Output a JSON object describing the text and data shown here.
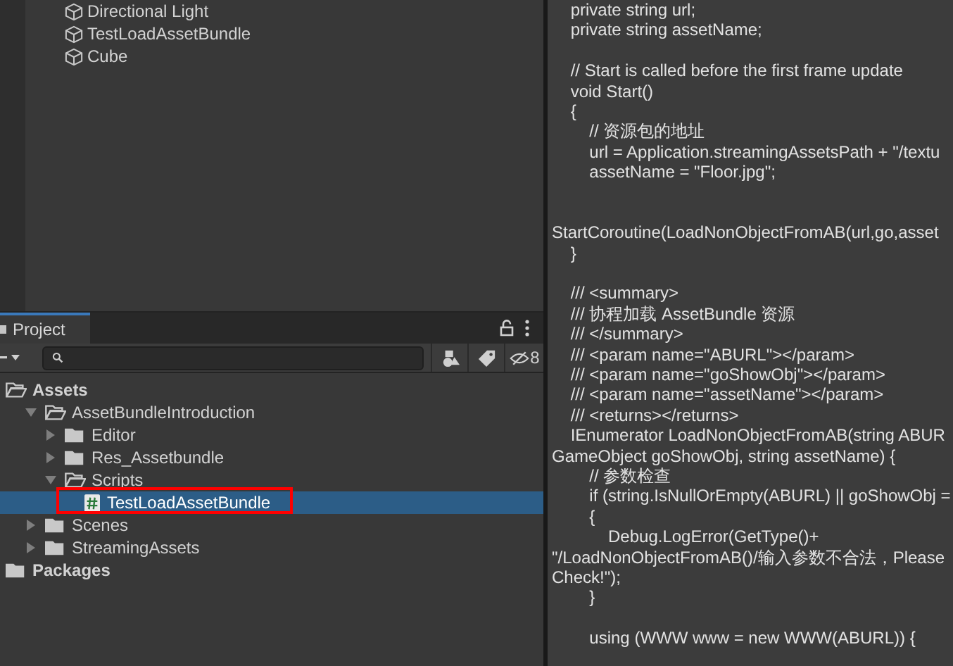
{
  "hierarchy": {
    "items": [
      {
        "label": "Directional Light"
      },
      {
        "label": "TestLoadAssetBundle"
      },
      {
        "label": "Cube"
      }
    ]
  },
  "project": {
    "tab": {
      "label": "Project",
      "selected": true
    },
    "hidden_count": "8",
    "tree": [
      {
        "label": "Assets",
        "kind": "folder",
        "root": true,
        "expanded": true,
        "selected": false,
        "highlighted": false,
        "children": [
          {
            "label": "AssetBundleIntroduction",
            "kind": "folder",
            "expanded": true,
            "selected": false,
            "highlighted": false,
            "children": [
              {
                "label": "Editor",
                "kind": "folder",
                "expanded": false,
                "selected": false,
                "highlighted": false
              },
              {
                "label": "Res_Assetbundle",
                "kind": "folder",
                "expanded": false,
                "selected": false,
                "highlighted": false
              },
              {
                "label": "Scripts",
                "kind": "folder",
                "expanded": true,
                "selected": false,
                "highlighted": false,
                "children": [
                  {
                    "label": "TestLoadAssetBundle",
                    "kind": "script",
                    "selected": true,
                    "highlighted": true
                  }
                ]
              }
            ]
          },
          {
            "label": "Scenes",
            "kind": "folder",
            "expanded": false,
            "selected": false,
            "highlighted": false
          },
          {
            "label": "StreamingAssets",
            "kind": "folder",
            "expanded": false,
            "selected": false,
            "highlighted": false
          }
        ]
      },
      {
        "label": "Packages",
        "kind": "folder",
        "root": true,
        "expanded": false,
        "selected": false,
        "highlighted": false
      }
    ]
  },
  "code": {
    "lines": [
      {
        "kind": "text",
        "text": "    private string url;"
      },
      {
        "kind": "text",
        "text": "    private string assetName;"
      },
      {
        "kind": "blank"
      },
      {
        "kind": "text",
        "text": "    // Start is called before the first frame update"
      },
      {
        "kind": "text",
        "text": "    void Start()"
      },
      {
        "kind": "text",
        "text": "    {"
      },
      {
        "kind": "text",
        "text": "        // 资源包的地址"
      },
      {
        "kind": "text",
        "text": "        url = Application.streamingAssetsPath + \"/textu"
      },
      {
        "kind": "text",
        "text": "        assetName = \"Floor.jpg\";"
      },
      {
        "kind": "blank"
      },
      {
        "kind": "blank"
      },
      {
        "kind": "text",
        "text": "StartCoroutine(LoadNonObjectFromAB(url,go,asset"
      },
      {
        "kind": "text",
        "text": "    }"
      },
      {
        "kind": "blank"
      },
      {
        "kind": "text",
        "text": "    /// <summary>"
      },
      {
        "kind": "text",
        "text": "    /// 协程加载 AssetBundle 资源"
      },
      {
        "kind": "text",
        "text": "    /// </summary>"
      },
      {
        "kind": "text",
        "text": "    /// <param name=\"ABURL\"></param>"
      },
      {
        "kind": "text",
        "text": "    /// <param name=\"goShowObj\"></param>"
      },
      {
        "kind": "text",
        "text": "    /// <param name=\"assetName\"></param>"
      },
      {
        "kind": "text",
        "text": "    /// <returns></returns>"
      },
      {
        "kind": "text",
        "text": "    IEnumerator LoadNonObjectFromAB(string ABUR"
      },
      {
        "kind": "text",
        "text": "GameObject goShowObj, string assetName) {"
      },
      {
        "kind": "text",
        "text": "        // 参数检查"
      },
      {
        "kind": "text",
        "text": "        if (string.IsNullOrEmpty(ABURL) || goShowObj ="
      },
      {
        "kind": "text",
        "text": "        {"
      },
      {
        "kind": "text",
        "text": "            Debug.LogError(GetType()+"
      },
      {
        "kind": "text",
        "text": "\"/LoadNonObjectFromAB()/输入参数不合法，Please"
      },
      {
        "kind": "text",
        "text": "Check!\");"
      },
      {
        "kind": "text",
        "text": "        }"
      },
      {
        "kind": "blank"
      },
      {
        "kind": "text",
        "text": "        using (WWW www = new WWW(ABURL)) {"
      }
    ]
  }
}
